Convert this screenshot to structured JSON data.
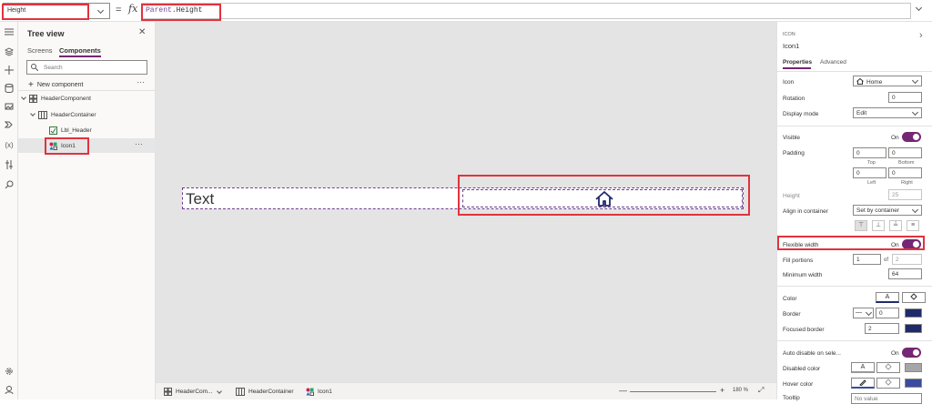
{
  "formula": {
    "property": "Height",
    "eq": "=",
    "fx": "fx",
    "object": "Parent",
    "dot": ".",
    "member": "Height"
  },
  "tree": {
    "title": "Tree view",
    "tabs": [
      "Screens",
      "Components"
    ],
    "search_placeholder": "Search",
    "new_component": "New component",
    "nodes": [
      "HeaderComponent",
      "HeaderContainer",
      "Lbl_Header",
      "Icon1"
    ]
  },
  "canvas": {
    "text": "Text"
  },
  "bottom": {
    "crumbs": [
      "HeaderCom...",
      "HeaderContainer",
      "Icon1"
    ],
    "zoom": "180 %"
  },
  "props": {
    "type": "ICON",
    "name": "Icon1",
    "tabs": [
      "Properties",
      "Advanced"
    ],
    "icon": {
      "label": "Icon",
      "value": "Home"
    },
    "rotation": {
      "label": "Rotation",
      "value": "0"
    },
    "display_mode": {
      "label": "Display mode",
      "value": "Edit"
    },
    "visible": {
      "label": "Visible",
      "state": "On"
    },
    "padding": {
      "label": "Padding",
      "top": "0",
      "bottom": "0",
      "left": "0",
      "right": "0",
      "top_label": "Top",
      "bottom_label": "Bottom",
      "left_label": "Left",
      "right_label": "Right"
    },
    "height": {
      "label": "Height",
      "value": "25"
    },
    "align": {
      "label": "Align in container",
      "value": "Set by container"
    },
    "flexible": {
      "label": "Flexible width",
      "state": "On"
    },
    "fill": {
      "label": "Fill portions",
      "value": "1",
      "of": "of",
      "total": "2"
    },
    "min_width": {
      "label": "Minimum width",
      "value": "64"
    },
    "color": {
      "label": "Color",
      "letter": "A"
    },
    "border": {
      "label": "Border",
      "value": "0"
    },
    "focused_border": {
      "label": "Focused border",
      "value": "2"
    },
    "auto_disable": {
      "label": "Auto disable on sele...",
      "state": "On"
    },
    "disabled_color": {
      "label": "Disabled color",
      "letter": "A"
    },
    "hover_color": {
      "label": "Hover color"
    },
    "tooltip": {
      "label": "Tooltip",
      "placeholder": "No value"
    }
  },
  "colors": {
    "accent": "#742774",
    "highlight": "#e0333d",
    "icon_navy": "#1f2a6b"
  }
}
